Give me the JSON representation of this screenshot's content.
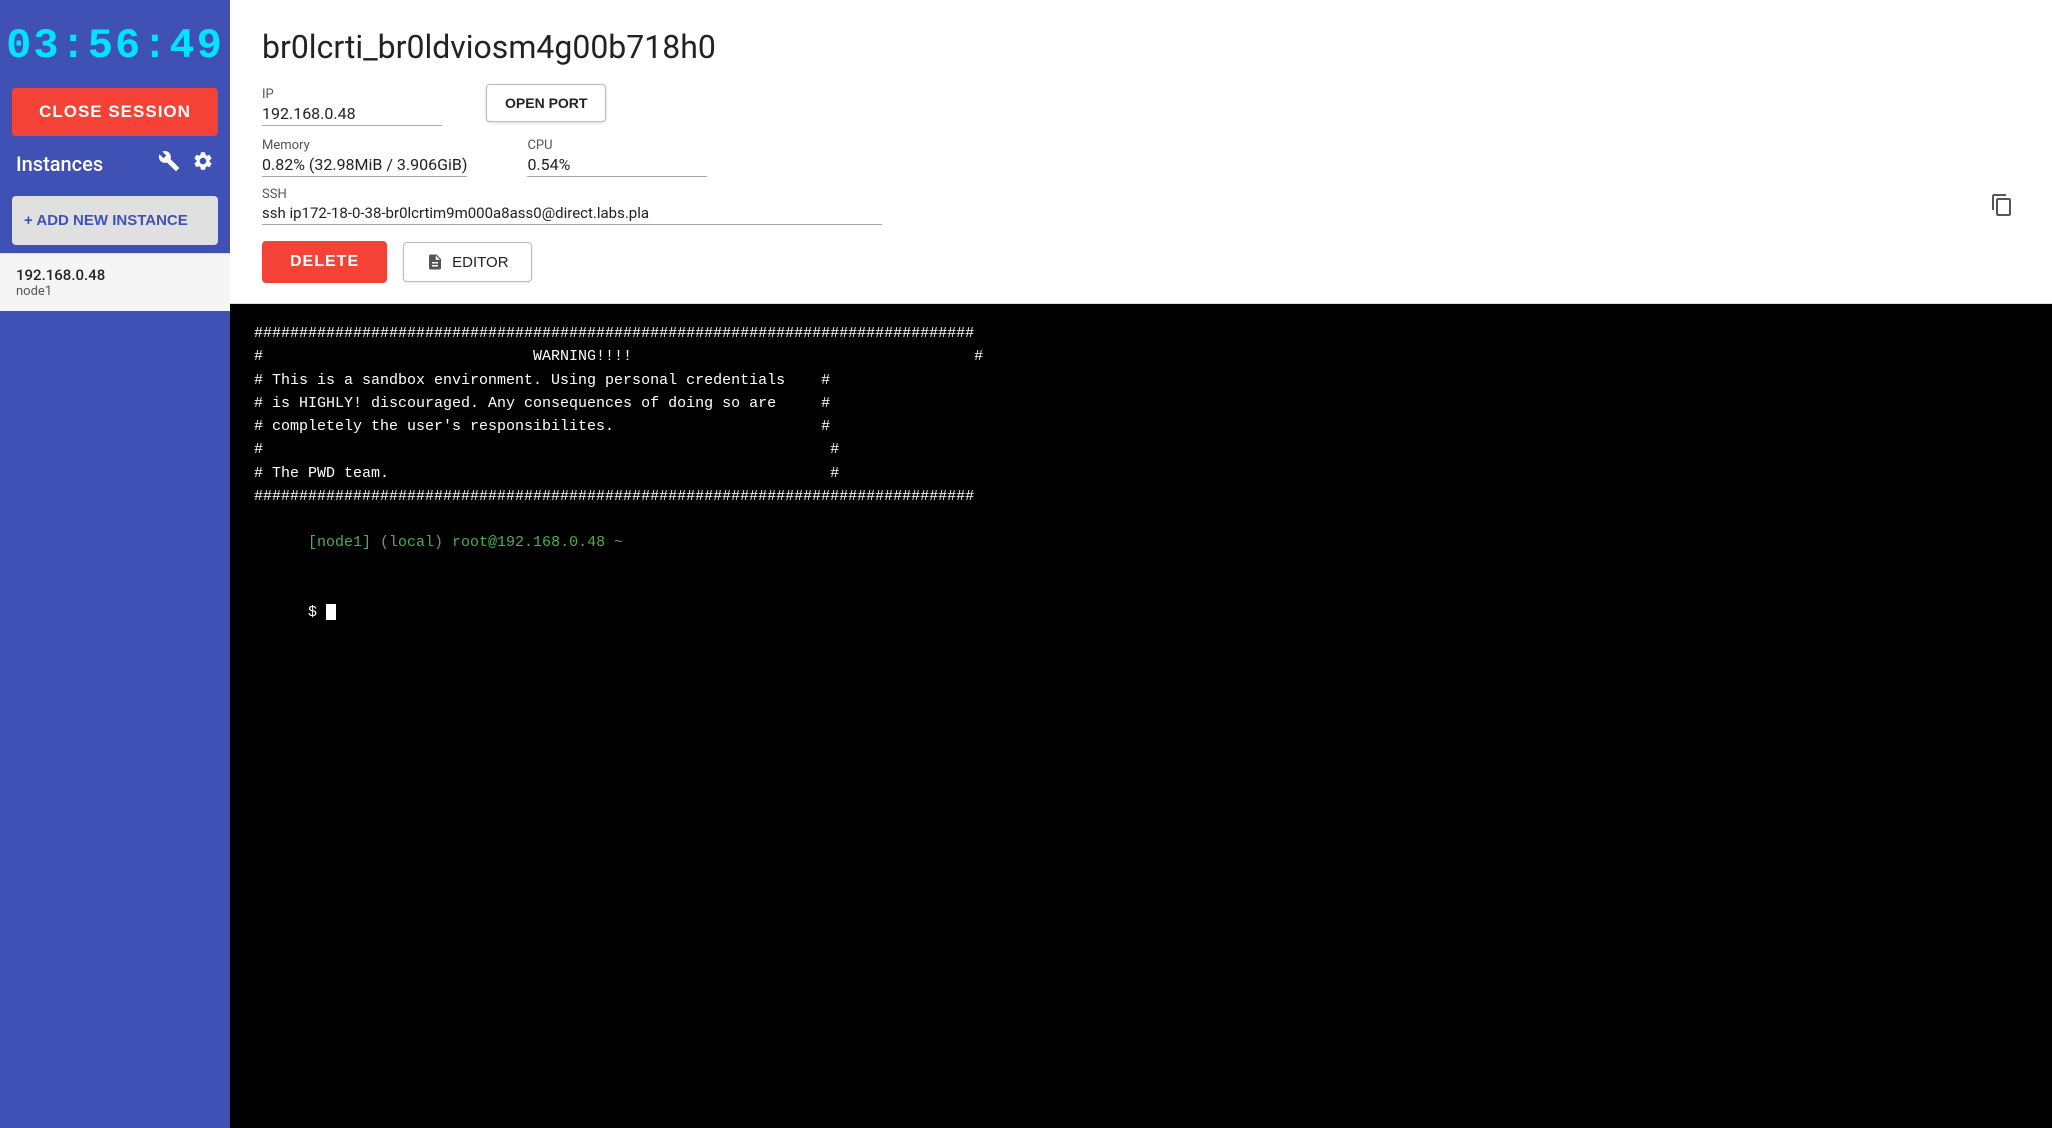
{
  "sidebar": {
    "timer": "03:56:49",
    "close_session_label": "CLOSE SESSION",
    "instances_label": "Instances",
    "wrench_icon": "⚙",
    "gear_icon": "⚙",
    "add_new_instance_label": "+ ADD NEW INSTANCE",
    "instances": [
      {
        "ip": "192.168.0.48",
        "name": "node1"
      }
    ]
  },
  "main": {
    "instance_title": "br0lcrti_br0ldviosm4g00b718h0",
    "ip_label": "IP",
    "ip_value": "192.168.0.48",
    "open_port_label": "OPEN PORT",
    "memory_label": "Memory",
    "memory_value": "0.82% (32.98MiB / 3.906GiB)",
    "cpu_label": "CPU",
    "cpu_value": "0.54%",
    "ssh_label": "SSH",
    "ssh_value": "ssh ip172-18-0-38-br0lcrtim9m000a8ass0@direct.labs.pla",
    "copy_icon": "⧉",
    "delete_label": "DELETE",
    "editor_label": "EDITOR",
    "editor_icon": "📄"
  },
  "terminal": {
    "lines": [
      "################################################################################",
      "#                              WARNING!!!!                                     #",
      "# This is a sandbox environment. Using personal credentials    #",
      "# is HIGHLY! discouraged. Any consequences of doing so are     #",
      "# completely the user's responsibilites.                       #",
      "#                                                               #",
      "# The PWD team.                                                 #",
      "################################################################################"
    ],
    "prompt_node1": "[node1]",
    "prompt_local": "(local)",
    "prompt_root": "root@192.168.0.48 ~",
    "prompt_dollar": "$"
  }
}
